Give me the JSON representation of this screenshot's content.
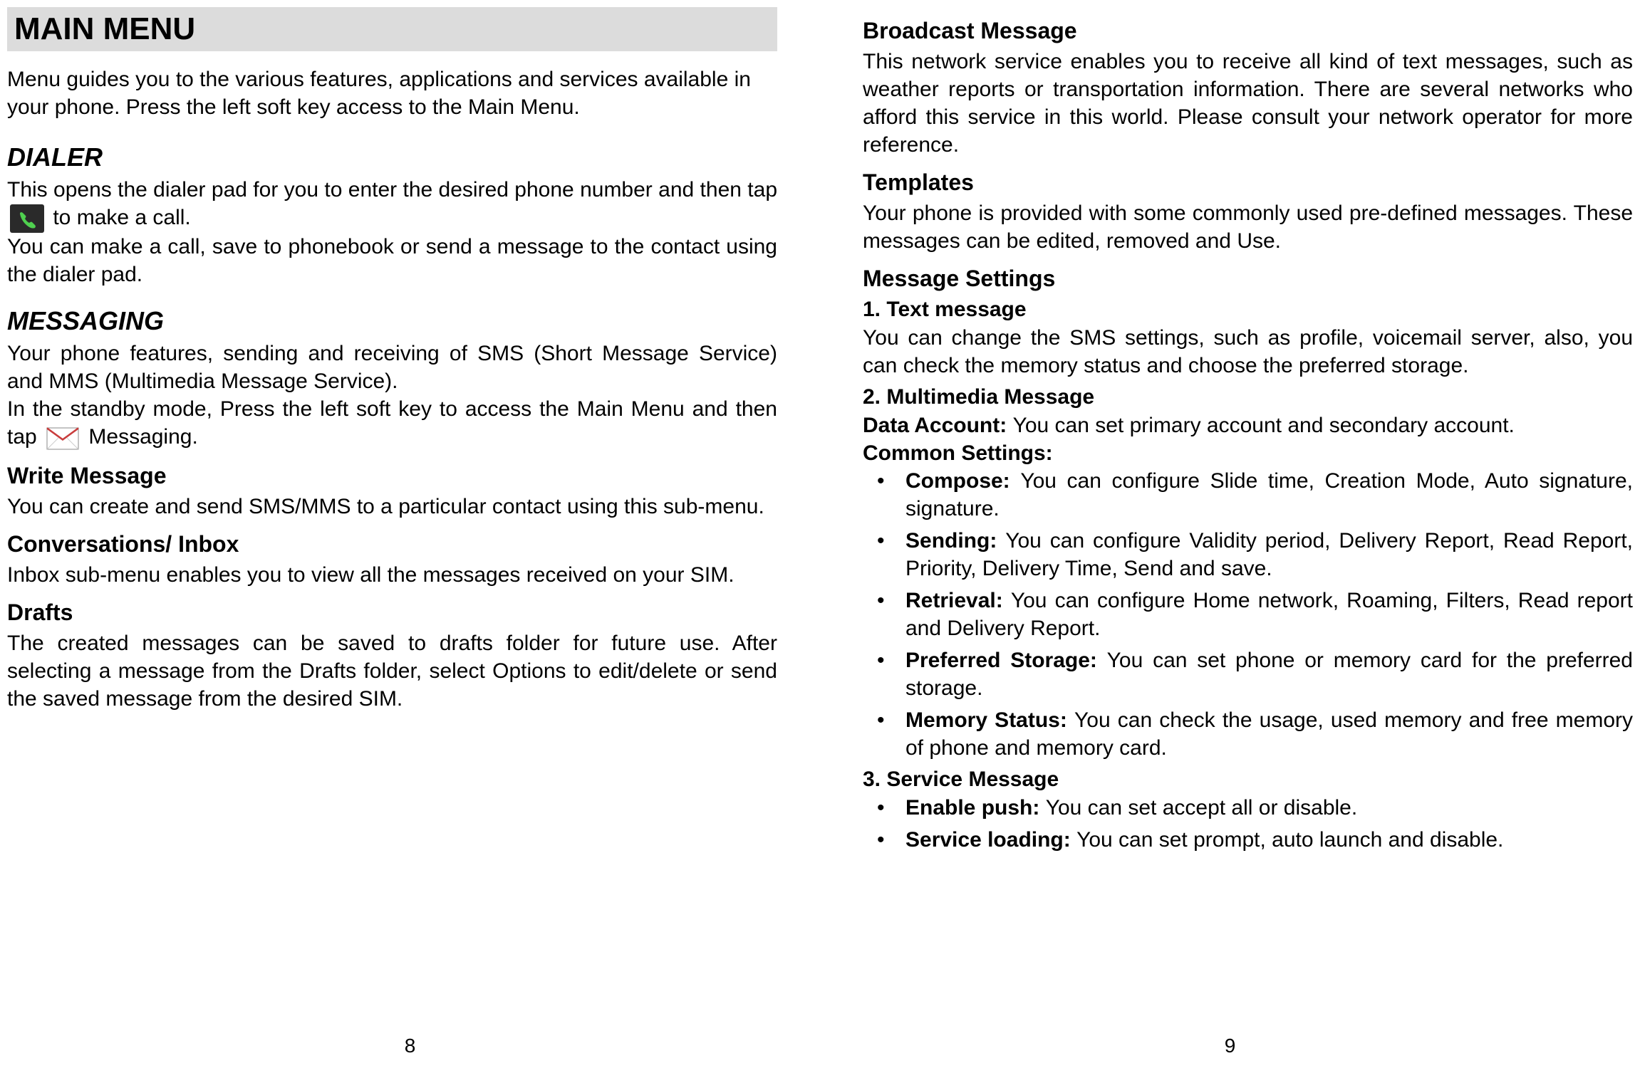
{
  "leftPage": {
    "title": "MAIN MENU",
    "intro": "Menu guides you to the various features, applications and services available in your phone. Press the left soft key access to the Main Menu.",
    "dialer": {
      "heading": "DIALER",
      "text1a": "This opens the dialer pad for you to enter the desired phone number and then tap ",
      "text1b": " to make a call.",
      "text2": "You can make a call, save to phonebook or send a message to the contact using the dialer pad."
    },
    "messaging": {
      "heading": "MESSAGING",
      "text1": "Your phone features, sending and receiving of SMS (Short Message Service) and MMS (Multimedia Message Service).",
      "text2a": "In the standby mode, Press the left soft key to access the Main Menu and then tap ",
      "text2b": " Messaging."
    },
    "writeMessage": {
      "heading": "Write Message",
      "text": "You can create and send SMS/MMS to a particular contact using this sub-menu."
    },
    "conversations": {
      "heading": "Conversations/ Inbox",
      "text": "Inbox sub-menu enables you to view all the messages received on your SIM."
    },
    "drafts": {
      "heading": "Drafts",
      "text": "The created messages can be saved to drafts folder for future use. After selecting a message from the Drafts folder, select Options to edit/delete or send the saved message from the desired SIM."
    },
    "pageNumber": "8"
  },
  "rightPage": {
    "broadcast": {
      "heading": "Broadcast Message",
      "text": "This network service enables you to receive all kind of text messages, such as weather reports or transportation information. There are several networks who afford this service in this world. Please consult your network operator for more reference."
    },
    "templates": {
      "heading": "Templates",
      "text": "Your phone is provided with some commonly used pre-defined messages. These messages can be edited, removed and Use."
    },
    "messageSettings": {
      "heading": "Message Settings",
      "textMessage": {
        "heading": "1. Text message",
        "text": "You can change the SMS settings, such as profile, voicemail server, also, you can check the memory status and choose the preferred storage."
      },
      "multimediaMessage": {
        "heading": "2. Multimedia Message",
        "dataAccountLabel": "Data Account: ",
        "dataAccountText": "You can set primary account and secondary account.",
        "commonSettingsLabel": "Common Settings:",
        "bullets": [
          {
            "label": "Compose: ",
            "text": "You can configure Slide time, Creation Mode, Auto signature, signature."
          },
          {
            "label": "Sending: ",
            "text": "You can configure Validity period, Delivery Report, Read Report, Priority, Delivery Time, Send and save."
          },
          {
            "label": "Retrieval: ",
            "text": "You can configure Home network, Roaming, Filters, Read report and Delivery Report."
          },
          {
            "label": "Preferred Storage: ",
            "text": "You can set phone or memory card for the preferred storage."
          },
          {
            "label": "Memory Status: ",
            "text": "You can check the usage, used memory and free memory of phone and memory card."
          }
        ]
      },
      "serviceMessage": {
        "heading": "3. Service Message",
        "bullets": [
          {
            "label": "Enable push: ",
            "text": "You can set accept all or disable."
          },
          {
            "label": "Service loading: ",
            "text": "You can set prompt, auto launch and disable."
          }
        ]
      }
    },
    "pageNumber": "9"
  }
}
